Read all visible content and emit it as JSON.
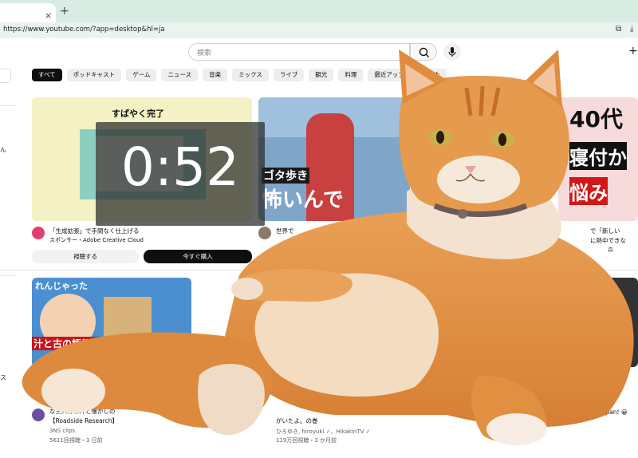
{
  "browser": {
    "url": "https://www.youtube.com/?app=desktop&hl=ja",
    "new_tab_label": "+",
    "close_tab_label": "×"
  },
  "header": {
    "search_placeholder": "検索",
    "create_label": "+"
  },
  "chips": [
    {
      "label": "すべて",
      "active": true
    },
    {
      "label": "ポッドキャスト"
    },
    {
      "label": "ゲーム"
    },
    {
      "label": "ニュース"
    },
    {
      "label": "音楽"
    },
    {
      "label": "ミックス"
    },
    {
      "label": "ライブ"
    },
    {
      "label": "観光"
    },
    {
      "label": "料理"
    },
    {
      "label": "最近アップロードされた"
    }
  ],
  "timer": {
    "value": "0:52"
  },
  "ad": {
    "thumb_title": "すばやく完了",
    "title": "「生成拡張」で手間なく仕上げる",
    "sponsor": "スポンサー・Adobe Creative Cloud",
    "view_button": "視聴する",
    "buy_button": "今すぐ購入"
  },
  "video2": {
    "thumb_text": "ゴタ歩き",
    "thumb_text2": "怖いんで",
    "title": "世界で"
  },
  "video3": {
    "thumb_line1": "40代",
    "thumb_line2": "寝付か",
    "thumb_line3": "悩み",
    "title": "で「新しい",
    "title2": "に熱中できな",
    "sub": "森"
  },
  "video4": {
    "thumb_top": "れんじゃった",
    "thumb_caption": "汁と古の語録と共に始まっ",
    "title": "な三人称は汁と懐かしの",
    "title2": "【Roadside Research】",
    "channel": "3NS clips",
    "stats": "5611回視聴・3 日前"
  },
  "video5": {
    "title": "がいたよ。の巻",
    "channel": "ひろゆき, hiroyuki ✓、HikakinTV ✓",
    "stats": "119万回視聴・3 か月前"
  },
  "video6": {
    "title": "uji in Japan! 😀"
  },
  "sidebar": {
    "char1": "ん",
    "char2": "ス"
  },
  "colors": {
    "chrome_bg": "#d9ece4",
    "urlbar_bg": "#e9f4ef",
    "cat_orange": "#e08a3c",
    "timer_overlay": "rgba(40,40,40,0.72)"
  }
}
